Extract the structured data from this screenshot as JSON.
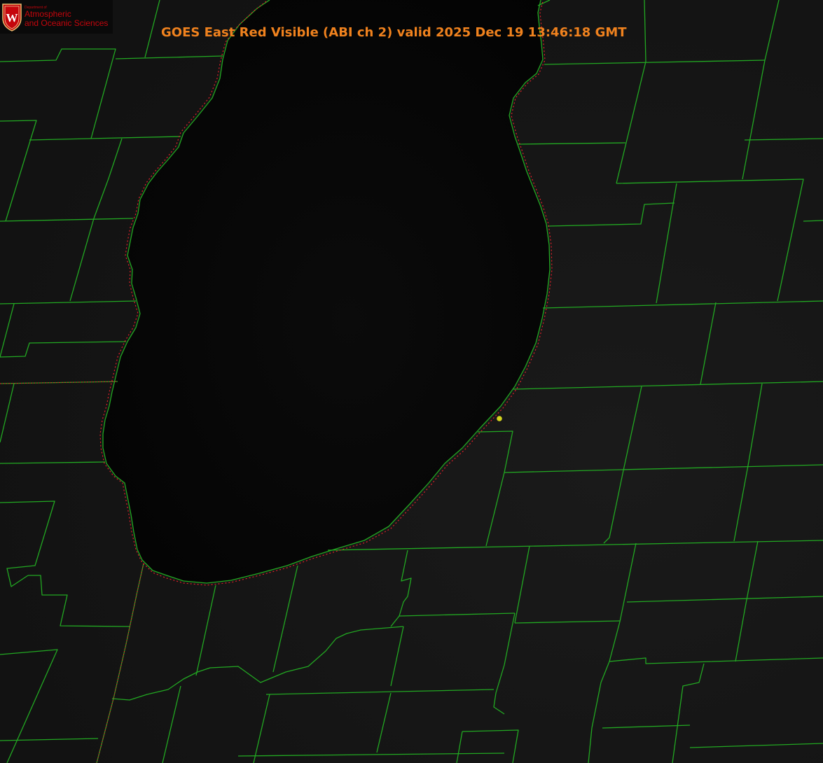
{
  "title": "GOES East Red Visible (ABI ch 2) valid 2025 Dec 19 13:46:18 GMT",
  "logo": {
    "department": "Department of",
    "line1": "Atmospheric",
    "line2": "and Oceanic Sciences",
    "crest_letter": "W"
  },
  "colors": {
    "title": "#f0821e",
    "logo_text": "#c5050c",
    "boundaries": "#22a822",
    "coastline": "#e0202a",
    "marker": "#d4d41e",
    "land": "#141414",
    "lake": "#040404"
  },
  "icons": {
    "crest": "university-crest-icon",
    "marker": "location-marker-icon"
  }
}
